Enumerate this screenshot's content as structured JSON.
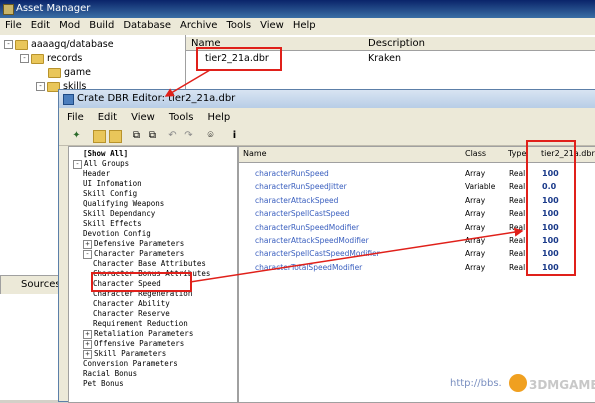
{
  "outer": {
    "title": "Asset Manager",
    "menu": [
      "File",
      "Edit",
      "Mod",
      "Build",
      "Database",
      "Archive",
      "Tools",
      "View",
      "Help"
    ],
    "tree": [
      {
        "label": "aaaagq/database",
        "toggle": "-"
      },
      {
        "label": "records",
        "toggle": "-"
      },
      {
        "label": "game",
        "toggle": ""
      },
      {
        "label": "skills",
        "toggle": "-"
      }
    ],
    "list_headers": [
      "Name",
      "Description"
    ],
    "list_rows": [
      {
        "name": "tier2_21a.dbr",
        "description": "Kraken"
      }
    ],
    "sources_tab": "Sources"
  },
  "dbr": {
    "title": "Crate DBR Editor: tier2_21a.dbr",
    "menu": [
      "File",
      "Edit",
      "View",
      "Tools",
      "Help"
    ],
    "toolbar_icons": [
      "wand-icon",
      "folder-open-icon",
      "folder-icon",
      "copy-icon",
      "paste-icon",
      "undo-icon",
      "redo-icon",
      "binoculars-icon",
      "info-icon"
    ],
    "tree": [
      {
        "label": "[Show All]",
        "level": 1,
        "toggle": "",
        "bold": true
      },
      {
        "label": "All Groups",
        "level": 0,
        "toggle": "-"
      },
      {
        "label": "Header",
        "level": 1,
        "toggle": ""
      },
      {
        "label": "UI Infomation",
        "level": 1,
        "toggle": ""
      },
      {
        "label": "Skill Config",
        "level": 1,
        "toggle": ""
      },
      {
        "label": "Qualifying Weapons",
        "level": 1,
        "toggle": ""
      },
      {
        "label": "Skill Dependancy",
        "level": 1,
        "toggle": ""
      },
      {
        "label": "Skill Effects",
        "level": 1,
        "toggle": ""
      },
      {
        "label": "Devotion Config",
        "level": 1,
        "toggle": ""
      },
      {
        "label": "Defensive Parameters",
        "level": 1,
        "toggle": "+"
      },
      {
        "label": "Character Parameters",
        "level": 1,
        "toggle": "-"
      },
      {
        "label": "Character Base Attributes",
        "level": 2,
        "toggle": ""
      },
      {
        "label": "Character Bonus Attributes",
        "level": 2,
        "toggle": ""
      },
      {
        "label": "Character Speed",
        "level": 2,
        "toggle": ""
      },
      {
        "label": "Character Regeneration",
        "level": 2,
        "toggle": ""
      },
      {
        "label": "Character Ability",
        "level": 2,
        "toggle": ""
      },
      {
        "label": "Character Reserve",
        "level": 2,
        "toggle": ""
      },
      {
        "label": "Requirement Reduction",
        "level": 2,
        "toggle": ""
      },
      {
        "label": "Retaliation Parameters",
        "level": 1,
        "toggle": "+"
      },
      {
        "label": "Offensive Parameters",
        "level": 1,
        "toggle": "+"
      },
      {
        "label": "Skill Parameters",
        "level": 1,
        "toggle": "+"
      },
      {
        "label": "Conversion Parameters",
        "level": 1,
        "toggle": ""
      },
      {
        "label": "Racial Bonus",
        "level": 1,
        "toggle": ""
      },
      {
        "label": "Pet Bonus",
        "level": 1,
        "toggle": ""
      }
    ],
    "grid_headers": {
      "name": "Name",
      "class": "Class",
      "type": "Type",
      "value": "tier2_21a.dbr"
    },
    "grid_rows": [
      {
        "name": "characterRunSpeed",
        "class": "Array",
        "type": "Real",
        "value": "100"
      },
      {
        "name": "characterRunSpeedJitter",
        "class": "Variable",
        "type": "Real",
        "value": "0.0"
      },
      {
        "name": "characterAttackSpeed",
        "class": "Array",
        "type": "Real",
        "value": "100"
      },
      {
        "name": "characterSpellCastSpeed",
        "class": "Array",
        "type": "Real",
        "value": "100"
      },
      {
        "name": "characterRunSpeedModifier",
        "class": "Array",
        "type": "Real",
        "value": "100"
      },
      {
        "name": "characterAttackSpeedModifier",
        "class": "Array",
        "type": "Real",
        "value": "100"
      },
      {
        "name": "characterSpellCastSpeedModifier",
        "class": "Array",
        "type": "Real",
        "value": "100"
      },
      {
        "name": "characterTotalSpeedModifier",
        "class": "Array",
        "type": "Real",
        "value": "100"
      }
    ]
  },
  "watermark": {
    "url": "http://bbs.",
    "brand": "3DMGAME"
  },
  "colors": {
    "highlight_box": "#e0201a",
    "title_gradient": "#0a246a",
    "value_text": "#1a3a8a",
    "name_text": "#3a5fbf"
  }
}
